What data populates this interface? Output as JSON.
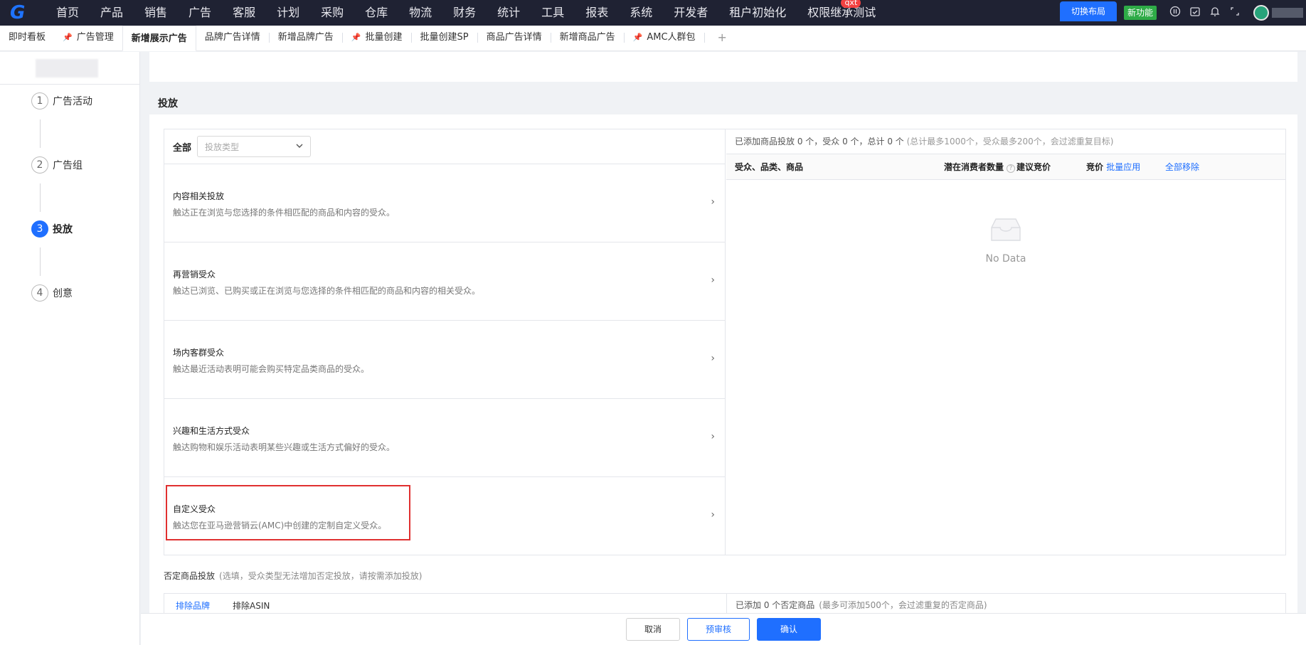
{
  "topbar": {
    "logo": "G",
    "nav": [
      "首页",
      "产品",
      "销售",
      "广告",
      "客服",
      "计划",
      "采购",
      "仓库",
      "物流",
      "财务",
      "统计",
      "工具",
      "报表",
      "系统",
      "开发者",
      "租户初始化",
      "权限继承测试"
    ],
    "nav_badge": "qxt",
    "switch_layout": "切换布局",
    "new_feature": "新功能"
  },
  "tabs": [
    {
      "label": "即时看板",
      "pinned": false
    },
    {
      "label": "广告管理",
      "pinned": true
    },
    {
      "label": "新增展示广告",
      "active": true
    },
    {
      "label": "品牌广告详情"
    },
    {
      "label": "新增品牌广告"
    },
    {
      "label": "批量创建",
      "pinned": true
    },
    {
      "label": "批量创建SP"
    },
    {
      "label": "商品广告详情"
    },
    {
      "label": "新增商品广告"
    },
    {
      "label": "AMC人群包",
      "pinned": true
    }
  ],
  "tab_add": "+",
  "steps": [
    {
      "num": "1",
      "label": "广告活动"
    },
    {
      "num": "2",
      "label": "广告组"
    },
    {
      "num": "3",
      "label": "投放",
      "active": true
    },
    {
      "num": "4",
      "label": "创意"
    }
  ],
  "section": {
    "title": "投放"
  },
  "filter": {
    "all_label": "全部",
    "select_placeholder": "投放类型"
  },
  "targeting_items": [
    {
      "name": "内容相关投放",
      "desc": "触达正在浏览与您选择的条件相匹配的商品和内容的受众。"
    },
    {
      "name": "再营销受众",
      "desc": "触达已浏览、已购买或正在浏览与您选择的条件相匹配的商品和内容的相关受众。"
    },
    {
      "name": "场内客群受众",
      "desc": "触达最近活动表明可能会购买特定品类商品的受众。"
    },
    {
      "name": "兴趣和生活方式受众",
      "desc": "触达购物和娱乐活动表明某些兴趣或生活方式偏好的受众。"
    },
    {
      "name": "自定义受众",
      "desc": "触达您在亚马逊营销云(AMC)中创建的定制自定义受众。"
    }
  ],
  "summary": {
    "text": "已添加商品投放 0 个，受众 0 个，总计 0 个",
    "hint": "(总计最多1000个，受众最多200个，会过滤重复目标)"
  },
  "table": {
    "col1": "受众、品类、商品",
    "col2": "潜在消费者数量",
    "col3": "建议竞价",
    "col4": "竞价",
    "batch_apply": "批量应用",
    "remove_all": "全部移除",
    "empty": "No Data"
  },
  "negative": {
    "title": "否定商品投放",
    "hint": "(选填，受众类型无法增加否定投放，请按需添加投放)",
    "tabs": [
      "排除品牌",
      "排除ASIN"
    ],
    "summary": "已添加 0 个否定商品",
    "summary_hint": "(最多可添加500个，会过滤重复的否定商品)"
  },
  "footer": {
    "cancel": "取消",
    "precheck": "预审核",
    "confirm": "确认"
  },
  "colors": {
    "primary": "#1f6fff",
    "topbar": "#1f2233",
    "highlight": "#e03030",
    "new_feature": "#2eab47"
  }
}
